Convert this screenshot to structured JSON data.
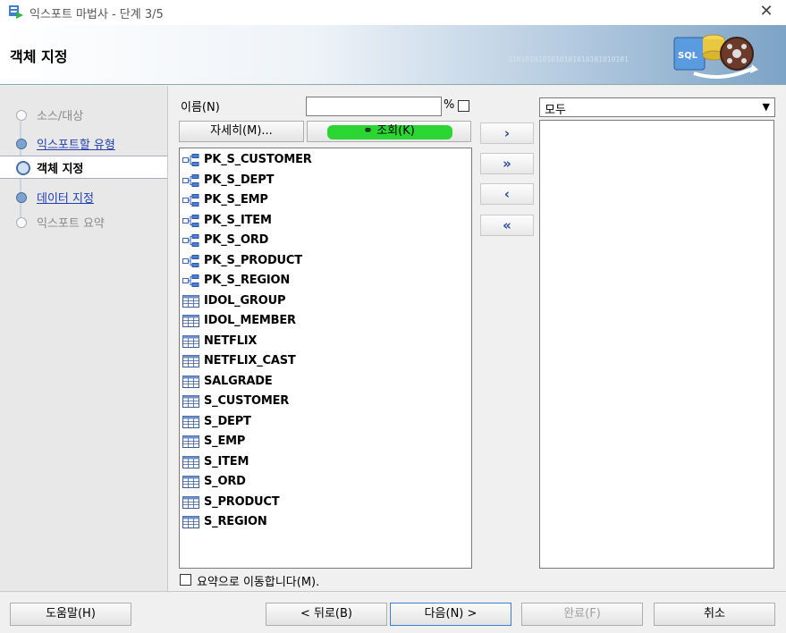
{
  "window": {
    "title": "익스포트 마법사 - 단계 3/5",
    "close_glyph": "✕"
  },
  "banner": {
    "heading": "객체 지정",
    "binary_text": "0101010101010101010101010101"
  },
  "steps": [
    {
      "label": "소스/대상",
      "state": "done"
    },
    {
      "label": "익스포트할 유형",
      "state": "link"
    },
    {
      "label": "객체 지정",
      "state": "active"
    },
    {
      "label": "데이터 지정",
      "state": "link"
    },
    {
      "label": "익스포트 요약",
      "state": "pending"
    }
  ],
  "filter": {
    "name_label": "이름(N)",
    "name_value": "",
    "percent": "%",
    "details_button": "자세히(M)...",
    "lookup_button": "조회(K)"
  },
  "objects": [
    {
      "name": "PK_S_CUSTOMER",
      "icon": "index-icon"
    },
    {
      "name": "PK_S_DEPT",
      "icon": "index-icon"
    },
    {
      "name": "PK_S_EMP",
      "icon": "index-icon"
    },
    {
      "name": "PK_S_ITEM",
      "icon": "index-icon"
    },
    {
      "name": "PK_S_ORD",
      "icon": "index-icon"
    },
    {
      "name": "PK_S_PRODUCT",
      "icon": "index-icon"
    },
    {
      "name": "PK_S_REGION",
      "icon": "index-icon"
    },
    {
      "name": "IDOL_GROUP",
      "icon": "table-icon"
    },
    {
      "name": "IDOL_MEMBER",
      "icon": "table-icon"
    },
    {
      "name": "NETFLIX",
      "icon": "table-icon"
    },
    {
      "name": "NETFLIX_CAST",
      "icon": "table-icon"
    },
    {
      "name": "SALGRADE",
      "icon": "table-icon"
    },
    {
      "name": "S_CUSTOMER",
      "icon": "table-icon"
    },
    {
      "name": "S_DEPT",
      "icon": "table-icon"
    },
    {
      "name": "S_EMP",
      "icon": "table-icon"
    },
    {
      "name": "S_ITEM",
      "icon": "table-icon"
    },
    {
      "name": "S_ORD",
      "icon": "table-icon"
    },
    {
      "name": "S_PRODUCT",
      "icon": "table-icon"
    },
    {
      "name": "S_REGION",
      "icon": "table-icon"
    }
  ],
  "transfer": {
    "add": "›",
    "add_all": "»",
    "remove": "‹",
    "remove_all": "«"
  },
  "target": {
    "combo_value": "모두",
    "caret": "▼"
  },
  "options": {
    "go_to_summary": "요약으로 이동합니다(M)."
  },
  "footer": {
    "help": "도움말(H)",
    "back": "< 뒤로(B)",
    "next": "다음(N) >",
    "finish": "완료(F)",
    "cancel": "취소"
  },
  "colors": {
    "highlight": "#2bd632",
    "link": "#1f3fae",
    "accent": "#2a4aa0"
  }
}
